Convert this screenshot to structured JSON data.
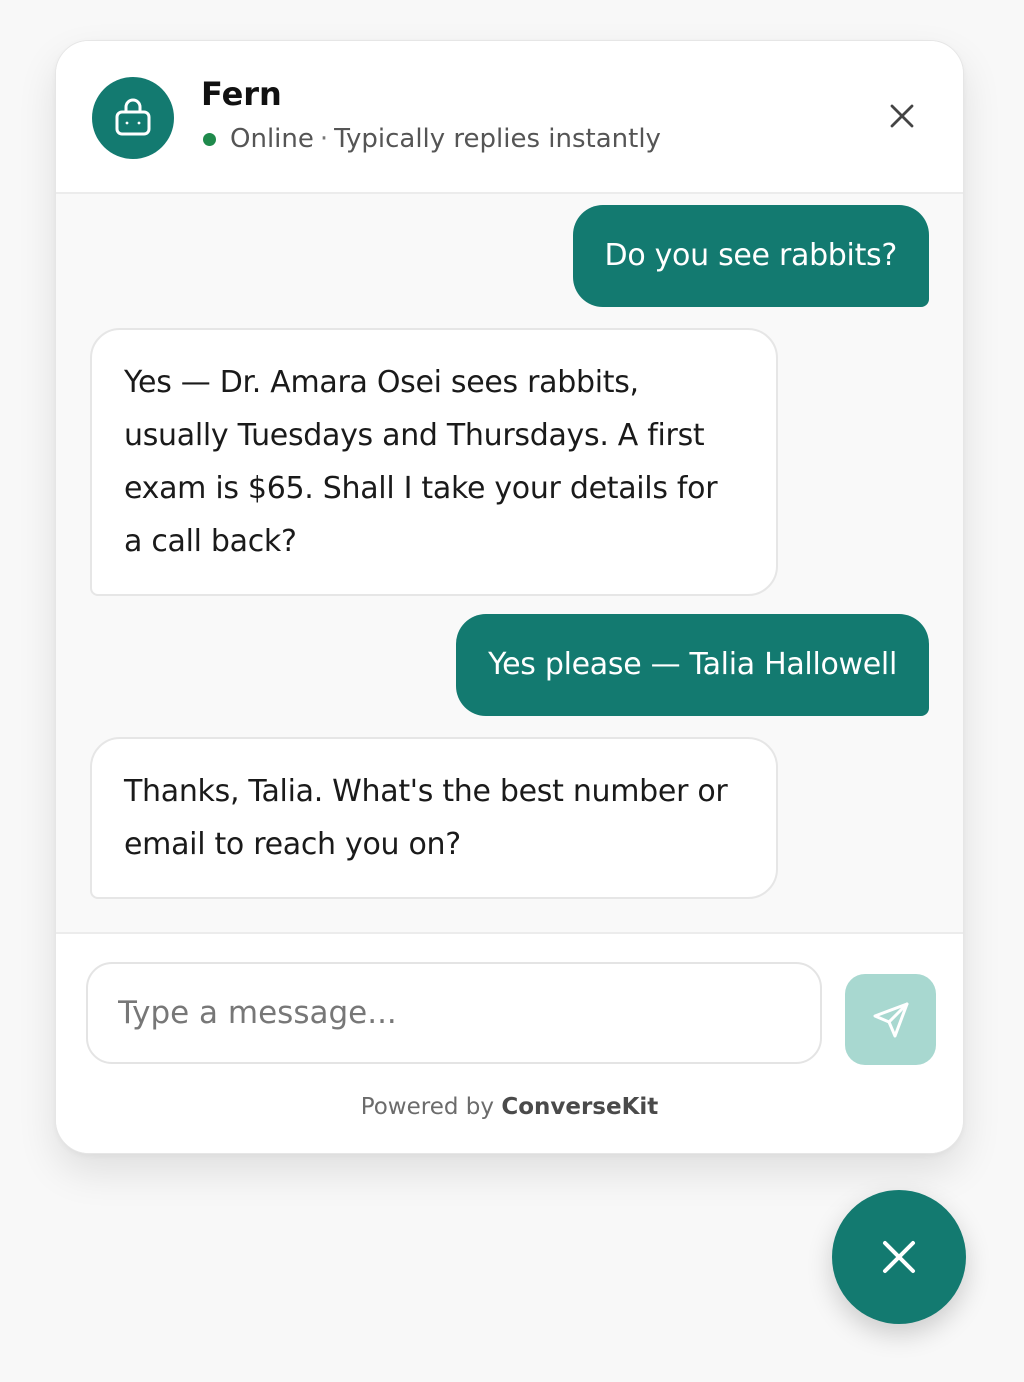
{
  "agent": {
    "name": "Fern",
    "status": "Online",
    "status_separator": "·",
    "reply_time": "Typically replies instantly",
    "avatar_icon": "robot-icon"
  },
  "messages": [
    {
      "from": "user",
      "text": "Do you see rabbits?"
    },
    {
      "from": "bot",
      "text": "Yes — Dr. Amara Osei sees rabbits, usually Tuesdays and Thursdays. A first exam is $65. Shall I take your details for a call back?"
    },
    {
      "from": "user",
      "text": "Yes please — Talia Hallowell"
    },
    {
      "from": "bot",
      "text": "Thanks, Talia. What's the best number or email to reach you on?"
    }
  ],
  "composer": {
    "placeholder": "Type a message...",
    "value": "",
    "send_icon": "send-icon"
  },
  "footer": {
    "powered_prefix": "Powered by",
    "brand": "ConverseKit"
  },
  "colors": {
    "accent": "#137a70",
    "send_disabled": "#a8d8d0",
    "online": "#1f8a4c"
  }
}
